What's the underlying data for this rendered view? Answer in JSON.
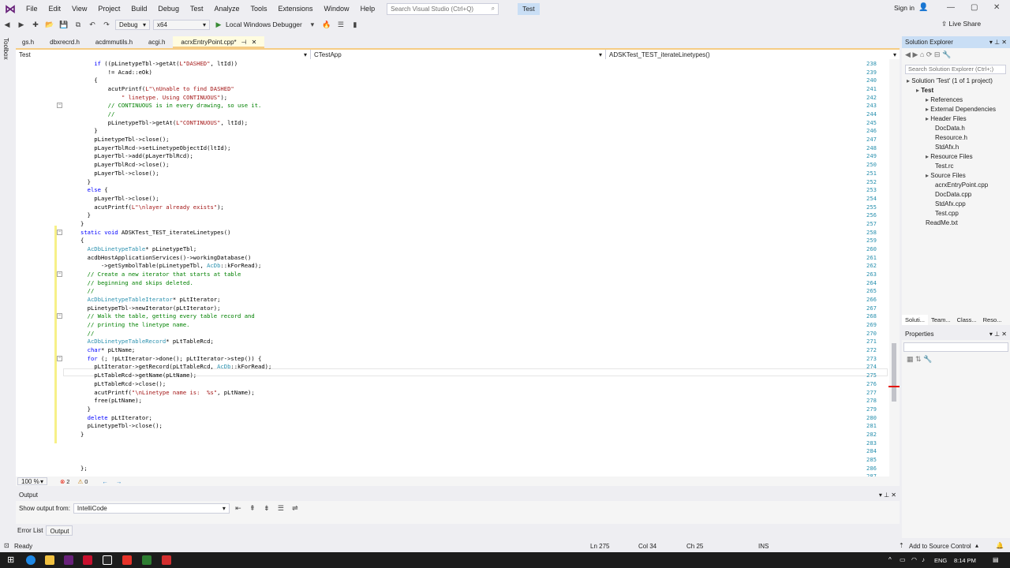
{
  "menu": [
    "File",
    "Edit",
    "View",
    "Project",
    "Build",
    "Debug",
    "Test",
    "Analyze",
    "Tools",
    "Extensions",
    "Window",
    "Help"
  ],
  "search": {
    "placeholder": "Search Visual Studio (Ctrl+Q)"
  },
  "solution_name": "Test",
  "sign_in": "Sign in",
  "toolbar": {
    "config": "Debug",
    "platform": "x64",
    "debugger": "Local Windows Debugger",
    "live_share": "Live Share"
  },
  "toolbox_label": "Toolbox",
  "doc_tabs": [
    {
      "label": "gs.h"
    },
    {
      "label": "dbxrecrd.h"
    },
    {
      "label": "acdmmutils.h"
    },
    {
      "label": "acgi.h"
    },
    {
      "label": "acrxEntryPoint.cpp*",
      "active": true
    }
  ],
  "nav": {
    "project": "Test",
    "class": "CTestApp",
    "member": "ADSKTest_TEST_iterateLinetypes()"
  },
  "code_lines": [
    {
      "n": "238",
      "t": "    if ((pLinetypeTbl->getAt(L\"DASHED\", ltId))"
    },
    {
      "n": "239",
      "t": "        != Acad::eOk)"
    },
    {
      "n": "240",
      "t": "    {"
    },
    {
      "n": "241",
      "t": "        acutPrintf(L\"\\nUnable to find DASHED\""
    },
    {
      "n": "242",
      "t": "            \" linetype. Using CONTINUOUS\");"
    },
    {
      "n": "243",
      "t": "        // CONTINUOUS is in every drawing, so use it."
    },
    {
      "n": "244",
      "t": "        //"
    },
    {
      "n": "245",
      "t": "        pLinetypeTbl->getAt(L\"CONTINUOUS\", ltId);"
    },
    {
      "n": "246",
      "t": "    }"
    },
    {
      "n": "247",
      "t": "    pLinetypeTbl->close();"
    },
    {
      "n": "248",
      "t": "    pLayerTblRcd->setLinetypeObjectId(ltId);"
    },
    {
      "n": "249",
      "t": "    pLayerTbl->add(pLayerTblRcd);"
    },
    {
      "n": "250",
      "t": "    pLayerTblRcd->close();"
    },
    {
      "n": "251",
      "t": "    pLayerTbl->close();"
    },
    {
      "n": "252",
      "t": "  }"
    },
    {
      "n": "253",
      "t": "  else {"
    },
    {
      "n": "254",
      "t": "    pLayerTbl->close();"
    },
    {
      "n": "255",
      "t": "    acutPrintf(L\"\\nlayer already exists\");"
    },
    {
      "n": "256",
      "t": "  }"
    },
    {
      "n": "257",
      "t": "}"
    },
    {
      "n": "258",
      "t": "static void ADSKTest_TEST_iterateLinetypes()"
    },
    {
      "n": "259",
      "t": "{"
    },
    {
      "n": "260",
      "t": "  AcDbLinetypeTable* pLinetypeTbl;"
    },
    {
      "n": "261",
      "t": "  acdbHostApplicationServices()->workingDatabase()"
    },
    {
      "n": "262",
      "t": "      ->getSymbolTable(pLinetypeTbl, AcDb::kForRead);"
    },
    {
      "n": "263",
      "t": "  // Create a new iterator that starts at table"
    },
    {
      "n": "264",
      "t": "  // beginning and skips deleted."
    },
    {
      "n": "265",
      "t": "  //"
    },
    {
      "n": "266",
      "t": "  AcDbLinetypeTableIterator* pLtIterator;"
    },
    {
      "n": "267",
      "t": "  pLinetypeTbl->newIterator(pLtIterator);"
    },
    {
      "n": "268",
      "t": "  // Walk the table, getting every table record and"
    },
    {
      "n": "269",
      "t": "  // printing the linetype name."
    },
    {
      "n": "270",
      "t": "  //"
    },
    {
      "n": "271",
      "t": "  AcDbLinetypeTableRecord* pLtTableRcd;"
    },
    {
      "n": "272",
      "t": "  char* pLtName;"
    },
    {
      "n": "273",
      "t": "  for (; !pLtIterator->done(); pLtIterator->step()) {"
    },
    {
      "n": "274",
      "t": "    pLtIterator->getRecord(pLtTableRcd, AcDb::kForRead);"
    },
    {
      "n": "275",
      "t": "    pLtTableRcd->getName(pLtName);"
    },
    {
      "n": "276",
      "t": "    pLtTableRcd->close();"
    },
    {
      "n": "277",
      "t": "    acutPrintf(\"\\nLinetype name is:  %s\", pLtName);"
    },
    {
      "n": "278",
      "t": "    free(pLtName);"
    },
    {
      "n": "279",
      "t": "  }"
    },
    {
      "n": "280",
      "t": "  delete pLtIterator;"
    },
    {
      "n": "281",
      "t": "  pLinetypeTbl->close();"
    },
    {
      "n": "282",
      "t": "}"
    },
    {
      "n": "283",
      "t": ""
    },
    {
      "n": "284",
      "t": ""
    },
    {
      "n": "285",
      "t": ""
    },
    {
      "n": "286",
      "t": "};"
    },
    {
      "n": "287",
      "t": ""
    }
  ],
  "editor_status": {
    "zoom": "100 %",
    "errors": "2",
    "warnings": "0"
  },
  "solution_explorer": {
    "title": "Solution Explorer",
    "search_placeholder": "Search Solution Explorer (Ctrl+;)",
    "nodes": [
      {
        "label": "Solution 'Test' (1 of 1 project)",
        "depth": 0
      },
      {
        "label": "Test",
        "depth": 1,
        "bold": true
      },
      {
        "label": "References",
        "depth": 2
      },
      {
        "label": "External Dependencies",
        "depth": 2
      },
      {
        "label": "Header Files",
        "depth": 2
      },
      {
        "label": "DocData.h",
        "depth": 3
      },
      {
        "label": "Resource.h",
        "depth": 3
      },
      {
        "label": "StdAfx.h",
        "depth": 3
      },
      {
        "label": "Resource Files",
        "depth": 2
      },
      {
        "label": "Test.rc",
        "depth": 3
      },
      {
        "label": "Source Files",
        "depth": 2
      },
      {
        "label": "acrxEntryPoint.cpp",
        "depth": 3
      },
      {
        "label": "DocData.cpp",
        "depth": 3
      },
      {
        "label": "StdAfx.cpp",
        "depth": 3
      },
      {
        "label": "Test.cpp",
        "depth": 3
      },
      {
        "label": "ReadMe.txt",
        "depth": 2
      }
    ],
    "tabs": [
      "Soluti...",
      "Team...",
      "Class...",
      "Reso..."
    ]
  },
  "properties": {
    "title": "Properties"
  },
  "output": {
    "title": "Output",
    "show_from_label": "Show output from:",
    "source": "IntelliCode"
  },
  "bottom_tabs": [
    "Error List",
    "Output"
  ],
  "status": {
    "ready": "Ready",
    "line": "Ln 275",
    "col": "Col 34",
    "ch": "Ch 25",
    "mode": "INS",
    "source_control": "Add to Source Control"
  },
  "tray": {
    "lang": "ENG",
    "time": "8:14 PM"
  },
  "colors": {
    "keyword": "#0000ff",
    "type": "#2b91af",
    "string": "#a31515",
    "comment": "#008000",
    "accent": "#007acc",
    "status_bar": "#eeeef2"
  }
}
